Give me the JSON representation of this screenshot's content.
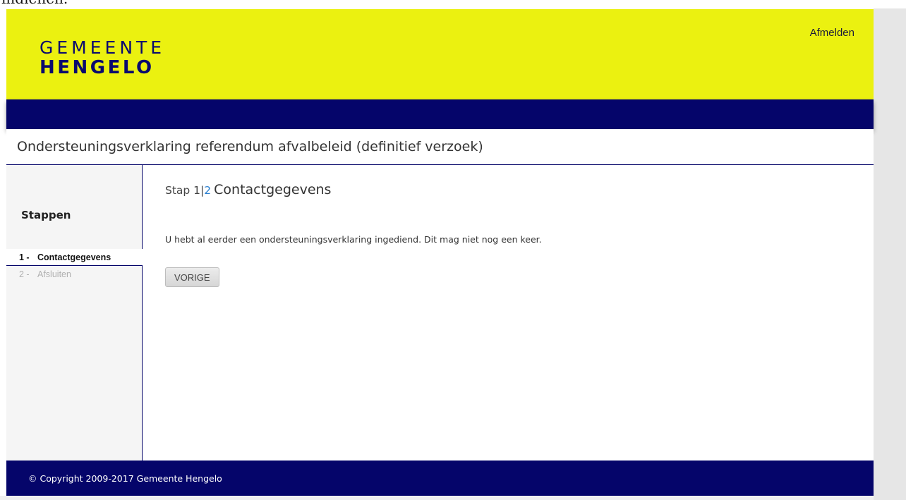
{
  "top_cut_text": "indienen.",
  "header": {
    "logo_line1": "GEMEENTE",
    "logo_line2": "HENGELO",
    "logout_label": "Afmelden"
  },
  "page": {
    "title": "Ondersteuningsverklaring referendum afvalbeleid (definitief verzoek)"
  },
  "sidebar": {
    "heading": "Stappen",
    "steps": [
      {
        "num": "1 -",
        "label": "Contactgegevens",
        "active": true
      },
      {
        "num": "2 -",
        "label": "Afsluiten",
        "active": false
      }
    ]
  },
  "content": {
    "step_label": "Stap 1",
    "step_sep": "|",
    "step_total": "2",
    "step_name": "Contactgegevens",
    "message": "U hebt al eerder een ondersteuningsverklaring ingediend. Dit mag niet nog een keer.",
    "prev_button": "VORIGE"
  },
  "footer": {
    "copyright": "© Copyright 2009-2017 Gemeente Hengelo"
  },
  "colors": {
    "header_bg": "#ebf110",
    "navy": "#05056a",
    "accent_blue": "#2a7fd0"
  }
}
